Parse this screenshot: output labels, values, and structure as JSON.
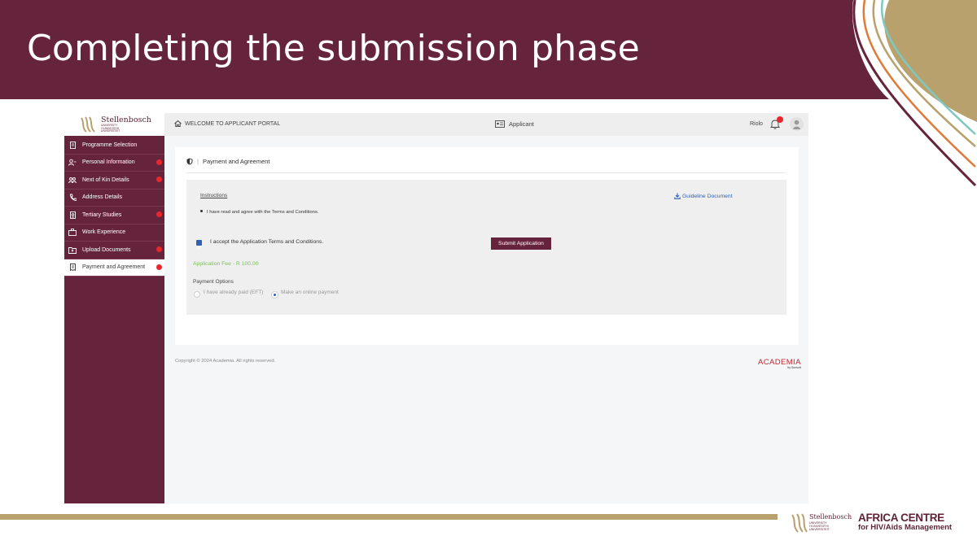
{
  "slide": {
    "title": "Completing the submission phase",
    "colors": {
      "maroon": "#66243c",
      "gold": "#b9a16d",
      "teal": "#7ec8c0",
      "orange": "#e07a3a"
    }
  },
  "logo": {
    "name": "Stellenbosch",
    "subtitle": "UNIVERSITY\nIYUNIVESITHI\nUNIVERSITEIT"
  },
  "footer_logo": {
    "su_name": "Stellenbosch",
    "su_subtitle": "UNIVERSITY\nIYUNIVESITHI\nUNIVERSITEIT",
    "africa_line1": "AFRICA CENTRE",
    "africa_line2": "for HIV/Aids Management"
  },
  "sidebar": {
    "items": [
      {
        "label": "Programme Selection",
        "icon": "document-icon",
        "badge": false,
        "active": false
      },
      {
        "label": "Personal Information",
        "icon": "person-card-icon",
        "badge": true,
        "active": false
      },
      {
        "label": "Next of Kin Details",
        "icon": "people-icon",
        "badge": true,
        "active": false
      },
      {
        "label": "Address Details",
        "icon": "phone-icon",
        "badge": false,
        "active": false
      },
      {
        "label": "Tertiary Studies",
        "icon": "certificate-icon",
        "badge": true,
        "active": false
      },
      {
        "label": "Work Experience",
        "icon": "briefcase-icon",
        "badge": false,
        "active": false
      },
      {
        "label": "Upload Documents",
        "icon": "folder-upload-icon",
        "badge": true,
        "active": false
      },
      {
        "label": "Payment and Agreement",
        "icon": "receipt-icon",
        "badge": true,
        "active": true
      }
    ]
  },
  "topbar": {
    "welcome": "WELCOME TO APPLICANT PORTAL",
    "role": "Applicant",
    "user": "Riolo"
  },
  "card": {
    "title": "Payment and Agreement",
    "instructions_link": "Instructions",
    "guideline_link": "Guideline Document",
    "bullet": "I have read and agree with the Terms and Conditions.",
    "accept_label": "I accept the Application Terms and Conditions.",
    "accept_checked": true,
    "submit_label": "Submit Application",
    "fee": "Application Fee - R 100.00",
    "payment_title": "Payment Options",
    "option_eft": "I have already paid (EFT)",
    "option_online": "Make an online payment",
    "selected_option": "online"
  },
  "footer": {
    "copyright": "Copyright © 2024 Academia. All rights reserved.",
    "brand": "ACADEMIA",
    "brand_sub": "by Sunsoft"
  }
}
